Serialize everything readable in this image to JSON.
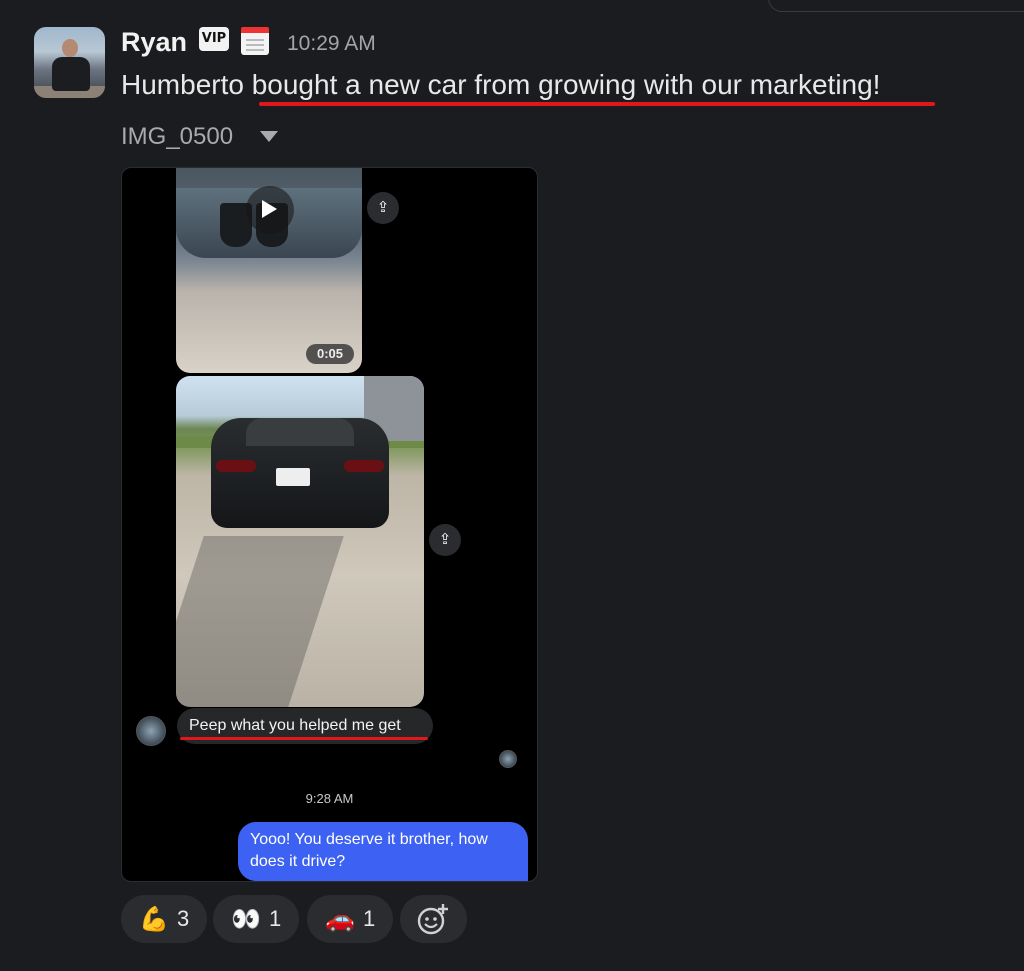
{
  "message": {
    "sender": "Ryan",
    "badge": "VIP",
    "time": "10:29 AM",
    "text_before": "Humberto ",
    "text_highlight": "bought a new car from growing with our marketing!",
    "attachment_name": "IMG_0500"
  },
  "screenshot": {
    "video_duration": "0:05",
    "incoming_text": "Peep what you helped me get",
    "timestamp": "9:28 AM",
    "outgoing_text": "Yooo! You deserve it brother, how does it drive?"
  },
  "reactions": [
    {
      "emoji": "💪",
      "count": "3"
    },
    {
      "emoji": "👀",
      "count": "1"
    },
    {
      "emoji": "🚗",
      "count": "1"
    }
  ],
  "colors": {
    "background": "#1b1c20",
    "accent_underline": "#e0181b",
    "outgoing_bubble": "#3d62f3"
  }
}
